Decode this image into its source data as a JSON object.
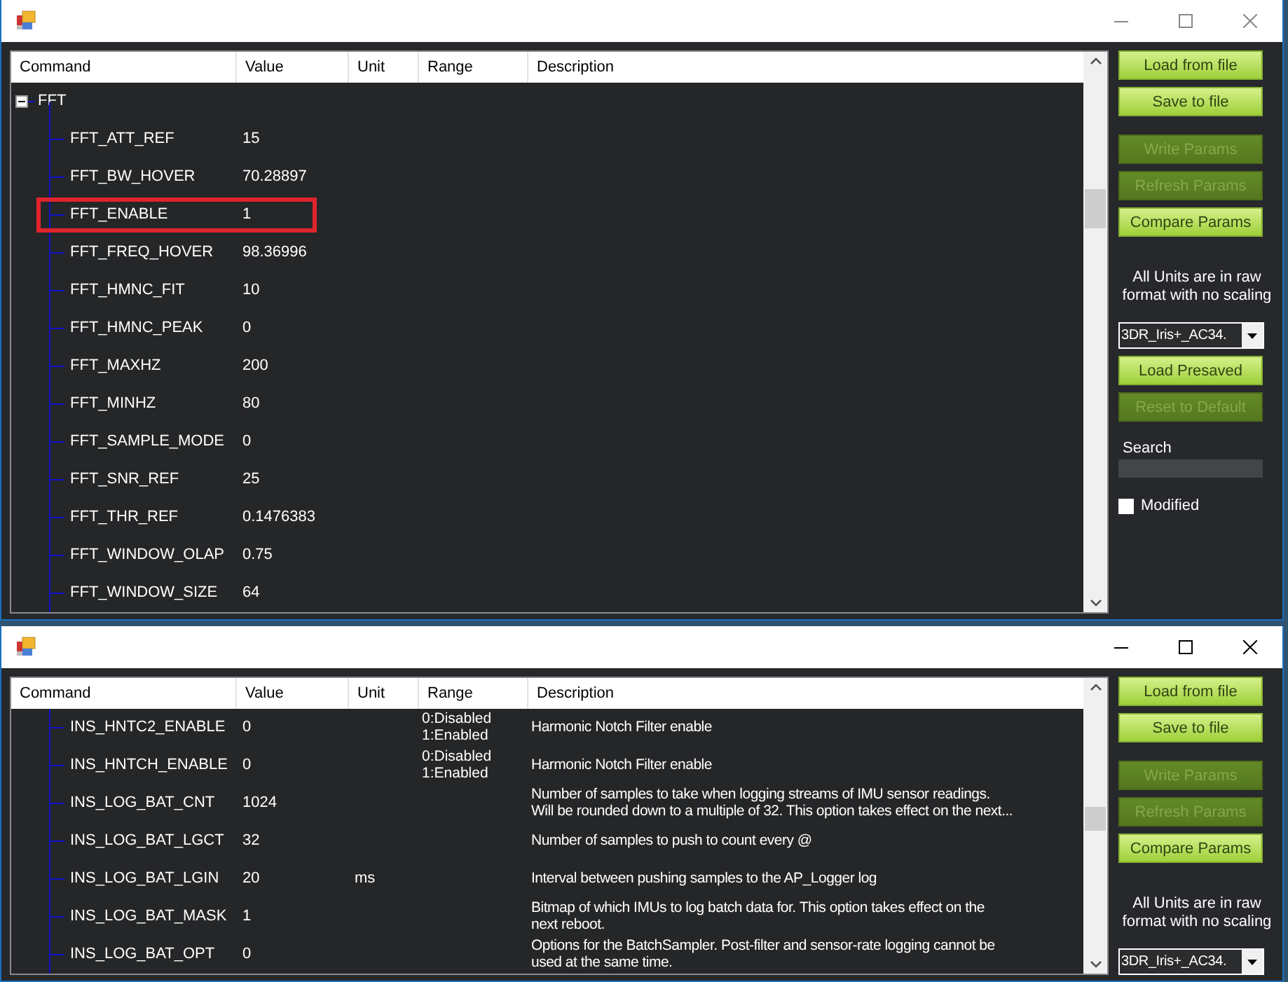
{
  "windows": [
    {
      "active": false,
      "table": {
        "columns": [
          "Command",
          "Value",
          "Unit",
          "Range",
          "Description"
        ],
        "rows": [
          {
            "kind": "group",
            "label": "FFT",
            "expanded": true,
            "children": [
              {
                "kind": "param",
                "command": "FFT_ATT_REF",
                "value": "15",
                "highlighted": false
              },
              {
                "kind": "param",
                "command": "FFT_BW_HOVER",
                "value": "70.28897",
                "highlighted": false
              },
              {
                "kind": "param",
                "command": "FFT_ENABLE",
                "value": "1",
                "highlighted": true
              },
              {
                "kind": "param",
                "command": "FFT_FREQ_HOVER",
                "value": "98.36996",
                "highlighted": false
              },
              {
                "kind": "param",
                "command": "FFT_HMNC_FIT",
                "value": "10",
                "highlighted": false
              },
              {
                "kind": "param",
                "command": "FFT_HMNC_PEAK",
                "value": "0",
                "highlighted": false
              },
              {
                "kind": "param",
                "command": "FFT_MAXHZ",
                "value": "200",
                "highlighted": false
              },
              {
                "kind": "param",
                "command": "FFT_MINHZ",
                "value": "80",
                "highlighted": false
              },
              {
                "kind": "param",
                "command": "FFT_SAMPLE_MODE",
                "value": "0",
                "highlighted": false
              },
              {
                "kind": "param",
                "command": "FFT_SNR_REF",
                "value": "25",
                "highlighted": false
              },
              {
                "kind": "param",
                "command": "FFT_THR_REF",
                "value": "0.1476383",
                "highlighted": false
              },
              {
                "kind": "param",
                "command": "FFT_WINDOW_OLAP",
                "value": "0.75",
                "highlighted": false
              },
              {
                "kind": "param",
                "command": "FFT_WINDOW_SIZE",
                "value": "64",
                "highlighted": false
              }
            ]
          }
        ]
      },
      "side_panel": [
        [
          {
            "kind": "button",
            "label": "Load from file",
            "disabled": false
          },
          {
            "kind": "button",
            "label": "Save to file",
            "disabled": false
          }
        ],
        [
          {
            "kind": "button",
            "label": "Write Params",
            "disabled": true
          },
          {
            "kind": "button",
            "label": "Refresh Params",
            "disabled": true
          },
          {
            "kind": "button",
            "label": "Compare Params",
            "disabled": false
          }
        ],
        [
          {
            "kind": "label",
            "label": "All Units are in raw format with no scaling"
          }
        ],
        [
          {
            "kind": "combo",
            "value": "3DR_Iris+_AC34."
          },
          {
            "kind": "button",
            "label": "Load Presaved",
            "disabled": false
          },
          {
            "kind": "button",
            "label": "Reset to Default",
            "disabled": true
          }
        ],
        [
          {
            "kind": "search",
            "label": "Search"
          }
        ],
        [
          {
            "kind": "checkbox",
            "label": "Modified",
            "checked": false
          }
        ]
      ]
    },
    {
      "active": true,
      "table": {
        "columns": [
          "Command",
          "Value",
          "Unit",
          "Range",
          "Description"
        ],
        "rows": [
          {
            "kind": "param",
            "command": "INS_HNTC2_ENABLE",
            "value": "0",
            "range": "0:Disabled\n1:Enabled",
            "description": "Harmonic Notch Filter enable",
            "highlighted": false
          },
          {
            "kind": "param",
            "command": "INS_HNTCH_ENABLE",
            "value": "0",
            "range": "0:Disabled\n1:Enabled",
            "description": "Harmonic Notch Filter enable",
            "highlighted": false
          },
          {
            "kind": "param",
            "command": "INS_LOG_BAT_CNT",
            "value": "1024",
            "description": "Number of samples to take when logging streams of IMU sensor readings.\nWill be rounded down to a multiple of 32. This option takes effect on the next...",
            "highlighted": false
          },
          {
            "kind": "param",
            "command": "INS_LOG_BAT_LGCT",
            "value": "32",
            "description": "Number of samples to push to count every @",
            "highlighted": false
          },
          {
            "kind": "param",
            "command": "INS_LOG_BAT_LGIN",
            "value": "20",
            "unit": "ms",
            "description": "Interval between pushing samples to the AP_Logger log",
            "highlighted": false
          },
          {
            "kind": "param",
            "command": "INS_LOG_BAT_MASK",
            "value": "1",
            "description": "Bitmap of which IMUs to log batch data for. This option takes effect on the\nnext reboot.",
            "highlighted": false
          },
          {
            "kind": "param",
            "command": "INS_LOG_BAT_OPT",
            "value": "0",
            "description": "Options for the BatchSampler. Post-filter and sensor-rate logging cannot be\nused at the same time.",
            "highlighted": false
          }
        ]
      },
      "side_panel": [
        [
          {
            "kind": "button",
            "label": "Load from file",
            "disabled": false
          },
          {
            "kind": "button",
            "label": "Save to file",
            "disabled": false
          }
        ],
        [
          {
            "kind": "button",
            "label": "Write Params",
            "disabled": true
          },
          {
            "kind": "button",
            "label": "Refresh Params",
            "disabled": true
          },
          {
            "kind": "button",
            "label": "Compare Params",
            "disabled": false
          }
        ],
        [
          {
            "kind": "label",
            "label": "All Units are in raw format with no scaling"
          }
        ],
        [
          {
            "kind": "combo",
            "value": "3DR_Iris+_AC34."
          }
        ]
      ]
    }
  ]
}
